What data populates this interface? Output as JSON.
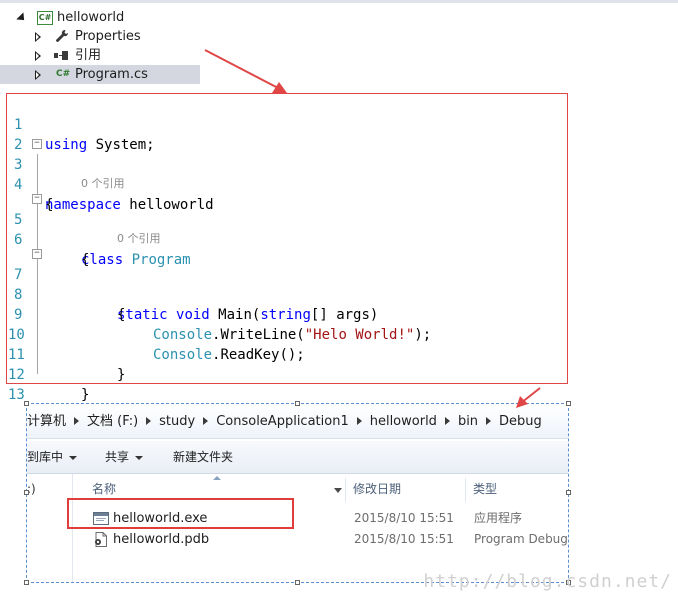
{
  "tree": {
    "project": "helloworld",
    "items": [
      {
        "label": "Properties"
      },
      {
        "label": "引用"
      },
      {
        "label": "Program.cs"
      }
    ]
  },
  "editor": {
    "line_numbers": [
      "1",
      "2",
      "3",
      "4",
      "5",
      "6",
      "7",
      "8",
      "9",
      "10",
      "11",
      "12",
      "13"
    ],
    "code": {
      "l1_kw": "using",
      "l1_rest": " System;",
      "l3_kw": "namespace",
      "l3_rest": " helloworld",
      "l4": "{",
      "lens_class": "0 个引用",
      "l5_kw": "class",
      "l5_type": "Program",
      "l6": "{",
      "lens_main": "0 个引用",
      "l7_kw1": "static",
      "l7_kw2": "void",
      "l7_name": "Main(",
      "l7_kw3": "string",
      "l7_rest": "[] args)",
      "l8": "{",
      "l9_type": "Console",
      "l9_call": ".WriteLine(",
      "l9_str": "\"Helo World!\"",
      "l9_end": ");",
      "l10_type": "Console",
      "l10_call": ".ReadKey();",
      "l11": "}",
      "l12": "}",
      "l13": "}"
    }
  },
  "explorer": {
    "breadcrumbs": [
      "计算机",
      "文档 (F:)",
      "study",
      "ConsoleApplication1",
      "helloworld",
      "bin",
      "Debug"
    ],
    "toolbar": {
      "include_in_library": "到库中",
      "share": "共享",
      "new_folder": "新建文件夹"
    },
    "nav_text": ":)",
    "columns": {
      "name": "名称",
      "modified": "修改日期",
      "type": "类型"
    },
    "files": [
      {
        "name": "helloworld.exe",
        "modified": "2015/8/10 15:51",
        "type": "应用程序",
        "icon": "exe-icon"
      },
      {
        "name": "helloworld.pdb",
        "modified": "2015/8/10 15:51",
        "type": "Program Debug",
        "icon": "pdb-icon"
      }
    ]
  },
  "watermark": "http://blog.csdn.net/",
  "colors": {
    "annotation_red": "#e04646",
    "keyword_blue": "#0000ff",
    "type_teal": "#2b91af",
    "string_red": "#a31515"
  }
}
